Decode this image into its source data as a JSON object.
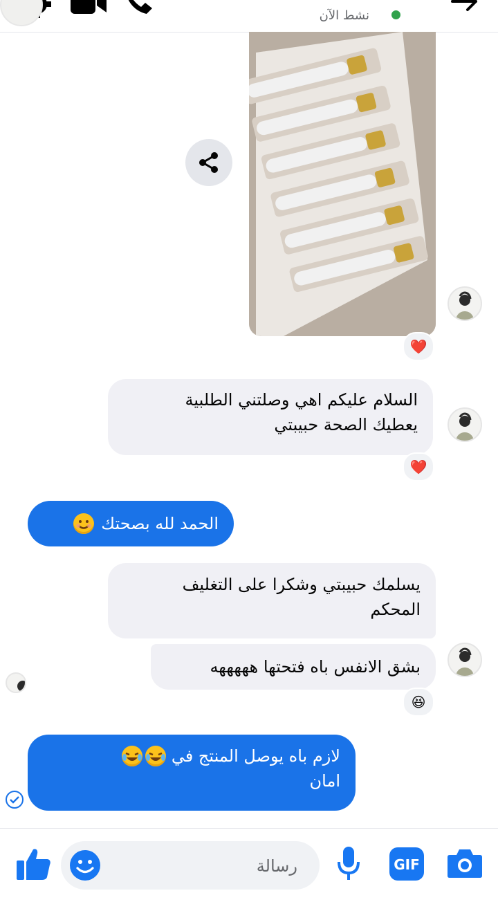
{
  "header": {
    "status": "نشط الآن"
  },
  "messages": {
    "m1": {
      "line1": "السلام عليكم اهي وصلتني الطلبية",
      "line2": "يعطيك الصحة حبيبتي"
    },
    "m2": {
      "text": "الحمد لله بصحتك"
    },
    "m3": {
      "line1": "يسلمك حبيبتي وشكرا على التغليف",
      "line2": "المحكم"
    },
    "m4": {
      "text": "بشق الانفس باه فتحتها هههههه"
    },
    "m5": {
      "line1": "لازم باه يوصل المنتج في",
      "line2": "امان"
    }
  },
  "reactions": {
    "photo": "❤️",
    "m1": "❤️",
    "m4": "😆"
  },
  "composer": {
    "placeholder": "رسالة"
  },
  "icons": [
    "gear-icon",
    "video-call-icon",
    "phone-icon",
    "back-arrow-icon",
    "share-icon",
    "like-icon",
    "emoji-icon",
    "microphone-icon",
    "gif-icon",
    "camera-icon",
    "seen-check-icon"
  ],
  "colors": {
    "accent": "#1a73e8",
    "incoming_bubble": "#f0f0f5",
    "online": "#31a24c",
    "heart": "#e41e3f"
  }
}
